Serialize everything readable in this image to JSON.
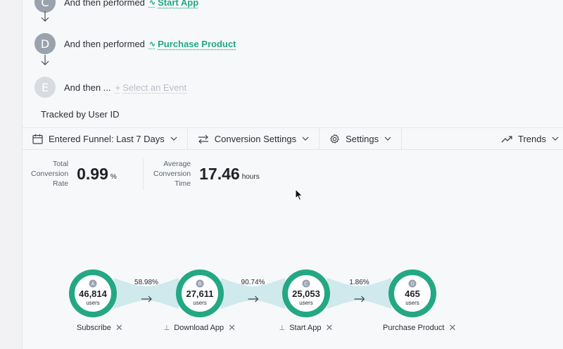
{
  "steps": [
    {
      "letter": "C",
      "text": "And then performed",
      "event": "Start App"
    },
    {
      "letter": "D",
      "text": "And then performed",
      "event": "Purchase Product"
    },
    {
      "letter": "E",
      "text": "And then ...",
      "event": "Select an Event"
    }
  ],
  "add_glyph": "+",
  "tracked_by": "Tracked by User ID",
  "toolbar": {
    "funnel_range": "Entered Funnel: Last 7 Days",
    "conversion_settings": "Conversion Settings",
    "settings": "Settings",
    "trends": "Trends"
  },
  "stats": {
    "total_label_1": "Total",
    "total_label_2": "Conversion",
    "total_label_3": "Rate",
    "total_value": "0.99",
    "total_unit": "%",
    "avg_label_1": "Average",
    "avg_label_2": "Conversion",
    "avg_label_3": "Time",
    "avg_value": "17.46",
    "avg_unit": "hours"
  },
  "funnel": {
    "users_word": "users",
    "nodes": [
      {
        "letter": "A",
        "count": "46,814",
        "name": "Subscribe",
        "pinned": false
      },
      {
        "letter": "B",
        "count": "27,611",
        "name": "Download App",
        "pinned": true
      },
      {
        "letter": "C",
        "count": "25,053",
        "name": "Start App",
        "pinned": true
      },
      {
        "letter": "D",
        "count": "465",
        "name": "Purchase Product",
        "pinned": false
      }
    ],
    "conversions": [
      "58.98%",
      "90.74%",
      "1.86%"
    ]
  },
  "colors": {
    "accent": "#21a883",
    "ring": "#23a883",
    "band": "#cfe9ec",
    "badge": "#9aa2ad"
  }
}
